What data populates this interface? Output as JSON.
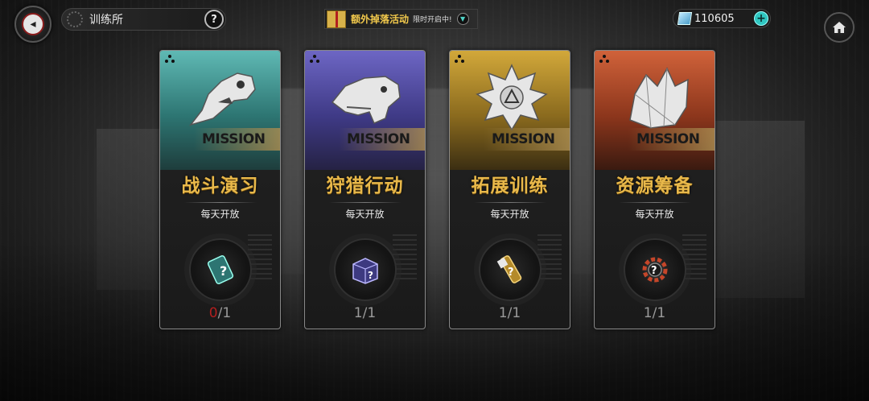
{
  "header": {
    "title": "训练所",
    "help_label": "?",
    "event_title": "额外掉落活动",
    "event_subtitle": "限时开启中!",
    "currency_value": "110605",
    "plus_label": "+"
  },
  "cards": [
    {
      "name": "战斗演习",
      "mission_label": "MISSION",
      "subtitle": "每天开放",
      "count_current": "0",
      "count_sep": "/",
      "count_total": "1",
      "theme_color": "#3a9c98",
      "emblem": "dinosaur-skull-icon",
      "reward": "battery-mystery-icon"
    },
    {
      "name": "狩猎行动",
      "mission_label": "MISSION",
      "subtitle": "每天开放",
      "count_current": "1",
      "count_sep": "/",
      "count_total": "1",
      "theme_color": "#5b55a8",
      "emblem": "trex-head-icon",
      "reward": "box-mystery-icon"
    },
    {
      "name": "拓展训练",
      "mission_label": "MISSION",
      "subtitle": "每天开放",
      "count_current": "1",
      "count_sep": "/",
      "count_total": "1",
      "theme_color": "#b08a2a",
      "emblem": "badge-medal-icon",
      "reward": "crystal-mystery-icon"
    },
    {
      "name": "资源筹备",
      "mission_label": "MISSION",
      "subtitle": "每天开放",
      "count_current": "1",
      "count_sep": "/",
      "count_total": "1",
      "theme_color": "#b54a2a",
      "emblem": "crystal-cluster-icon",
      "reward": "gear-mystery-icon"
    }
  ]
}
